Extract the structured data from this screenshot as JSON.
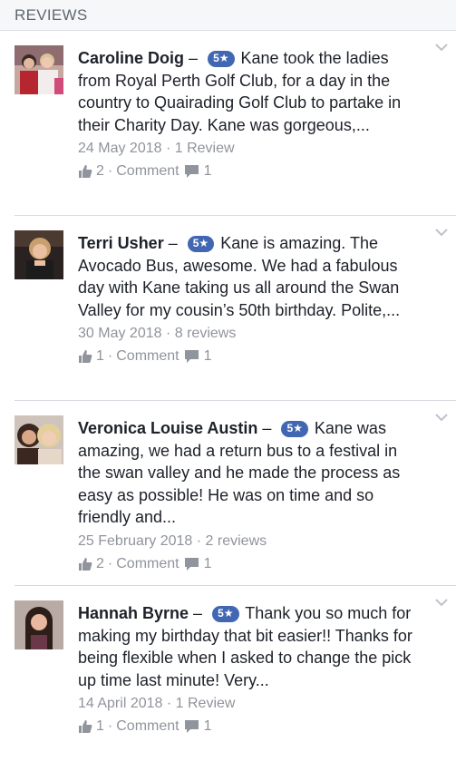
{
  "header": {
    "title": "REVIEWS"
  },
  "reviews": [
    {
      "name": "Caroline Doig",
      "dash": "–",
      "rating": "5★",
      "text": "Kane took the ladies from Royal Perth Golf Club, for a day in the country to Quairading Golf Club to partake in their Charity Day. Kane was gorgeous,...",
      "date": "24 May 2018",
      "review_count": "1 Review",
      "likes": "2",
      "comment_label": "Comment",
      "comments": "1"
    },
    {
      "name": "Terri Usher",
      "dash": "–",
      "rating": "5★",
      "text": "Kane is amazing. The Avocado Bus, awesome. We had a fabulous day with Kane taking us all around the Swan Valley for my cousin’s 50th birthday. Polite,...",
      "date": "30 May 2018",
      "review_count": "8 reviews",
      "likes": "1",
      "comment_label": "Comment",
      "comments": "1"
    },
    {
      "name": "Veronica Louise Austin",
      "dash": "–",
      "rating": "5★",
      "text": "Kane was amazing, we had a return bus to a festival in the swan valley and he made the process as easy as possible! He was on time and so friendly and...",
      "date": "25 February 2018",
      "review_count": "2 reviews",
      "likes": "2",
      "comment_label": "Comment",
      "comments": "1"
    },
    {
      "name": "Hannah Byrne",
      "dash": "–",
      "rating": "5★",
      "text": "Thank you so much for making my birthday that bit easier!! Thanks for being flexible when I asked to change the pick up time last minute! Very...",
      "date": "14 April 2018",
      "review_count": "1 Review",
      "likes": "1",
      "comment_label": "Comment",
      "comments": "1"
    }
  ],
  "colors": {
    "badge": "#4267b2",
    "meta": "#90949c",
    "header_bg": "#f6f7f9"
  },
  "icons": {
    "like": "thumbs-up-icon",
    "comment": "speech-bubble-icon",
    "menu": "chevron-down-icon"
  }
}
